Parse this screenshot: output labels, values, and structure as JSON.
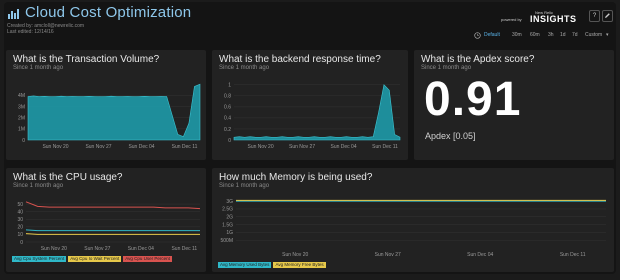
{
  "header": {
    "title": "Cloud Cost Optimization",
    "created_by": "Created by: amcloll@newrelic.com",
    "last_edited": "Last edited: 12/14/16",
    "powered_by": "powered by",
    "brand_small": "New Relic",
    "brand": "INSIGHTS",
    "help_icon": "?",
    "colors": {
      "title": "#8ec7ea",
      "accent": "#5ab4ea"
    }
  },
  "time_range": {
    "options": [
      "Default",
      "30m",
      "60m",
      "3h",
      "1d",
      "7d",
      "Custom"
    ],
    "selected": "Default"
  },
  "panels": {
    "transaction": {
      "title": "What is the Transaction Volume?",
      "subtitle": "Since 1 month ago"
    },
    "backend": {
      "title": "What is the backend response time?",
      "subtitle": "Since 1 month ago"
    },
    "apdex": {
      "title": "What is the Apdex score?",
      "subtitle": "Since 1 month ago",
      "value": "0.91",
      "label": "Apdex [0.05]"
    },
    "cpu": {
      "title": "What is the CPU usage?",
      "subtitle": "Since 1 month ago",
      "legend": [
        "Avg Cpu System Percent",
        "Avg Cpu Io Wait Percent",
        "Avg Cpu User Percent"
      ]
    },
    "memory": {
      "title": "How much Memory is being used?",
      "subtitle": "Since 1 month ago",
      "legend": [
        "Avg Memory Used Bytes",
        "Avg Memory Free Bytes"
      ]
    }
  },
  "chart_data": [
    {
      "id": "transaction",
      "type": "area",
      "x_ticks": [
        "Sun Nov 20",
        "Sun Nov 27",
        "Sun Dec 04",
        "Sun Dec 11"
      ],
      "y_ticks": [
        "0",
        "1M",
        "2M",
        "3M",
        "4M"
      ],
      "ylim": [
        0,
        5.2
      ],
      "unit": "M",
      "color": "#1e9aa8",
      "values": [
        3.9,
        3.95,
        3.9,
        3.92,
        3.88,
        3.9,
        3.93,
        3.9,
        3.91,
        3.89,
        3.9,
        3.92,
        3.9,
        3.88,
        3.9,
        3.93,
        3.9,
        3.9,
        3.91,
        3.88,
        3.9,
        3.92,
        3.9,
        3.89,
        3.91,
        3.9,
        2.2,
        0.5,
        0.3,
        1.5,
        4.8,
        5.0
      ]
    },
    {
      "id": "backend",
      "type": "area",
      "x_ticks": [
        "Sun Nov 20",
        "Sun Nov 27",
        "Sun Dec 04",
        "Sun Dec 11"
      ],
      "y_ticks": [
        "0",
        "0.2",
        "0.4",
        "0.6",
        "0.8",
        "1"
      ],
      "ylim": [
        0,
        1.05
      ],
      "color": "#1e9aa8",
      "values": [
        0.05,
        0.06,
        0.05,
        0.06,
        0.05,
        0.05,
        0.06,
        0.05,
        0.05,
        0.06,
        0.05,
        0.05,
        0.06,
        0.05,
        0.05,
        0.06,
        0.05,
        0.05,
        0.06,
        0.05,
        0.05,
        0.06,
        0.05,
        0.05,
        0.06,
        0.05,
        0.06,
        0.5,
        1.0,
        0.9,
        0.1,
        0.05
      ]
    },
    {
      "id": "cpu",
      "type": "line",
      "x_ticks": [
        "Sun Nov 20",
        "Sun Nov 27",
        "Sun Dec 04",
        "Sun Dec 11"
      ],
      "y_ticks": [
        "0",
        "10",
        "20",
        "30",
        "40",
        "50"
      ],
      "ylim": [
        0,
        58
      ],
      "series": [
        {
          "name": "Avg Cpu System Percent",
          "color": "#2fb8c8",
          "values": [
            16,
            15,
            15,
            15,
            15,
            15,
            15,
            15,
            15,
            15,
            15,
            15,
            15,
            15,
            15,
            15
          ]
        },
        {
          "name": "Avg Cpu Io Wait Percent",
          "color": "#e6c84a",
          "values": [
            11,
            10,
            10,
            10,
            10,
            10,
            10,
            10,
            10,
            10,
            10,
            10,
            10,
            10,
            10,
            10
          ]
        },
        {
          "name": "Avg Cpu User Percent",
          "color": "#d9534f",
          "values": [
            53,
            47,
            46,
            46,
            46,
            46,
            46,
            46,
            46,
            46,
            46,
            46,
            45,
            45,
            45,
            44
          ]
        }
      ]
    },
    {
      "id": "memory",
      "type": "line",
      "x_ticks": [
        "Sun Nov 20",
        "Sun Nov 27",
        "Sun Dec 04",
        "Sun Dec 11"
      ],
      "y_ticks": [
        "500M",
        "1G",
        "1.5G",
        "2G",
        "2.5G",
        "3G"
      ],
      "ylim": [
        0,
        3.2
      ],
      "series": [
        {
          "name": "Avg Memory Used Bytes",
          "color": "#2fb8c8",
          "values": [
            3.0,
            3.0,
            3.0,
            3.0,
            3.0,
            3.0,
            3.0,
            3.0
          ]
        },
        {
          "name": "Avg Memory Free Bytes",
          "color": "#e6c84a",
          "values": [
            3.05,
            3.05,
            3.05,
            3.05,
            3.05,
            3.05,
            3.05,
            3.05
          ]
        }
      ]
    }
  ]
}
